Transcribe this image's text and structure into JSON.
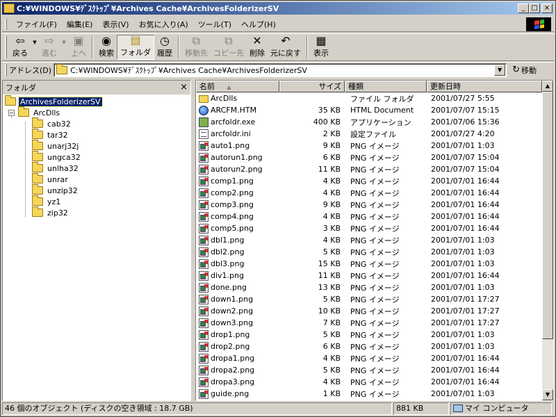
{
  "window": {
    "title": "C:¥WINDOWS¥ﾃﾞｽｸﾄｯﾌﾟ¥Archives Cache¥ArchivesFolderizerSV",
    "controls": {
      "minimize": "_",
      "maximize": "□",
      "close": "×"
    }
  },
  "menu": [
    "ファイル(F)",
    "編集(E)",
    "表示(V)",
    "お気に入り(A)",
    "ツール(T)",
    "ヘルプ(H)"
  ],
  "toolbar": [
    {
      "label": "戻る",
      "icon": "back-arrow-icon",
      "glyph": "⇦",
      "disabled": false,
      "dropdown": true
    },
    {
      "label": "進む",
      "icon": "forward-arrow-icon",
      "glyph": "⇨",
      "disabled": true,
      "dropdown": true
    },
    {
      "label": "上へ",
      "icon": "up-folder-icon",
      "glyph": "▣",
      "disabled": true
    },
    {
      "label": "検索",
      "icon": "search-icon",
      "glyph": "◉",
      "disabled": false
    },
    {
      "label": "フォルダ",
      "icon": "folders-icon",
      "glyph": "▤",
      "disabled": false,
      "pressed": true
    },
    {
      "label": "履歴",
      "icon": "history-icon",
      "glyph": "◷",
      "disabled": false
    },
    {
      "label": "移動先",
      "icon": "move-to-icon",
      "glyph": "⧉",
      "disabled": true
    },
    {
      "label": "コピー先",
      "icon": "copy-to-icon",
      "glyph": "⧉",
      "disabled": true
    },
    {
      "label": "削除",
      "icon": "delete-icon",
      "glyph": "✕",
      "disabled": false
    },
    {
      "label": "元に戻す",
      "icon": "undo-icon",
      "glyph": "↶",
      "disabled": false
    },
    {
      "label": "表示",
      "icon": "views-icon",
      "glyph": "▦",
      "disabled": false,
      "dropdown": true
    }
  ],
  "address": {
    "label": "アドレス(D)",
    "value": "C:¥WINDOWS¥ﾃﾞｽｸﾄｯﾌﾟ¥Archives Cache¥ArchivesFolderizerSV",
    "go_label": "移動"
  },
  "folder_pane": {
    "title": "フォルダ",
    "close_glyph": "×",
    "root": "ArchivesFolderizerSV",
    "child": "ArcDlls",
    "expander_glyph": "−",
    "subfolders": [
      "cab32",
      "tar32",
      "unarj32j",
      "ungca32",
      "unlha32",
      "unrar",
      "unzip32",
      "yz1",
      "zip32"
    ]
  },
  "list": {
    "columns": {
      "name": "名前",
      "sort_glyph": "▲",
      "size": "サイズ",
      "type": "種類",
      "date": "更新日時"
    },
    "rows": [
      {
        "name": "ArcDlls",
        "size": "",
        "type": "ファイル フォルダ",
        "date": "2001/07/27 5:55",
        "icon": "folder"
      },
      {
        "name": "ARCFM.HTM",
        "size": "35 KB",
        "type": "HTML Document",
        "date": "2001/07/07 15:15",
        "icon": "htm"
      },
      {
        "name": "arcfoldr.exe",
        "size": "400 KB",
        "type": "アプリケーション",
        "date": "2001/07/06 15:36",
        "icon": "exe"
      },
      {
        "name": "arcfoldr.ini",
        "size": "2 KB",
        "type": "設定ファイル",
        "date": "2001/07/27 4:20",
        "icon": "ini"
      },
      {
        "name": "auto1.png",
        "size": "9 KB",
        "type": "PNG イメージ",
        "date": "2001/07/01 1:03",
        "icon": "png"
      },
      {
        "name": "autorun1.png",
        "size": "6 KB",
        "type": "PNG イメージ",
        "date": "2001/07/07 15:04",
        "icon": "png"
      },
      {
        "name": "autorun2.png",
        "size": "11 KB",
        "type": "PNG イメージ",
        "date": "2001/07/07 15:04",
        "icon": "png"
      },
      {
        "name": "comp1.png",
        "size": "4 KB",
        "type": "PNG イメージ",
        "date": "2001/07/01 16:44",
        "icon": "png"
      },
      {
        "name": "comp2.png",
        "size": "4 KB",
        "type": "PNG イメージ",
        "date": "2001/07/01 16:44",
        "icon": "png"
      },
      {
        "name": "comp3.png",
        "size": "9 KB",
        "type": "PNG イメージ",
        "date": "2001/07/01 16:44",
        "icon": "png"
      },
      {
        "name": "comp4.png",
        "size": "4 KB",
        "type": "PNG イメージ",
        "date": "2001/07/01 16:44",
        "icon": "png"
      },
      {
        "name": "comp5.png",
        "size": "3 KB",
        "type": "PNG イメージ",
        "date": "2001/07/01 16:44",
        "icon": "png"
      },
      {
        "name": "dbl1.png",
        "size": "4 KB",
        "type": "PNG イメージ",
        "date": "2001/07/01 1:03",
        "icon": "png"
      },
      {
        "name": "dbl2.png",
        "size": "5 KB",
        "type": "PNG イメージ",
        "date": "2001/07/01 1:03",
        "icon": "png"
      },
      {
        "name": "dbl3.png",
        "size": "15 KB",
        "type": "PNG イメージ",
        "date": "2001/07/01 1:03",
        "icon": "png"
      },
      {
        "name": "div1.png",
        "size": "11 KB",
        "type": "PNG イメージ",
        "date": "2001/07/01 16:44",
        "icon": "png"
      },
      {
        "name": "done.png",
        "size": "13 KB",
        "type": "PNG イメージ",
        "date": "2001/07/01 1:03",
        "icon": "png"
      },
      {
        "name": "down1.png",
        "size": "5 KB",
        "type": "PNG イメージ",
        "date": "2001/07/01 17:27",
        "icon": "png"
      },
      {
        "name": "down2.png",
        "size": "10 KB",
        "type": "PNG イメージ",
        "date": "2001/07/01 17:27",
        "icon": "png"
      },
      {
        "name": "down3.png",
        "size": "7 KB",
        "type": "PNG イメージ",
        "date": "2001/07/01 17:27",
        "icon": "png"
      },
      {
        "name": "drop1.png",
        "size": "5 KB",
        "type": "PNG イメージ",
        "date": "2001/07/01 1:03",
        "icon": "png"
      },
      {
        "name": "drop2.png",
        "size": "6 KB",
        "type": "PNG イメージ",
        "date": "2001/07/01 1:03",
        "icon": "png"
      },
      {
        "name": "dropa1.png",
        "size": "4 KB",
        "type": "PNG イメージ",
        "date": "2001/07/01 16:44",
        "icon": "png"
      },
      {
        "name": "dropa2.png",
        "size": "5 KB",
        "type": "PNG イメージ",
        "date": "2001/07/01 16:44",
        "icon": "png"
      },
      {
        "name": "dropa3.png",
        "size": "4 KB",
        "type": "PNG イメージ",
        "date": "2001/07/01 16:44",
        "icon": "png"
      },
      {
        "name": "guide.png",
        "size": "1 KB",
        "type": "PNG イメージ",
        "date": "2001/07/01 1:03",
        "icon": "png"
      }
    ]
  },
  "status": {
    "objects": "46 個のオブジェクト (ディスクの空き領域 : 18.7 GB)",
    "size": "881 KB",
    "zone": "マイ コンピュータ"
  },
  "scrollbar": {
    "up_glyph": "▲",
    "down_glyph": "▼"
  },
  "colors": {
    "selection": "#0a246a",
    "titlebar_start": "#0a246a",
    "titlebar_end": "#a6caf0",
    "face": "#d4d0c8"
  }
}
